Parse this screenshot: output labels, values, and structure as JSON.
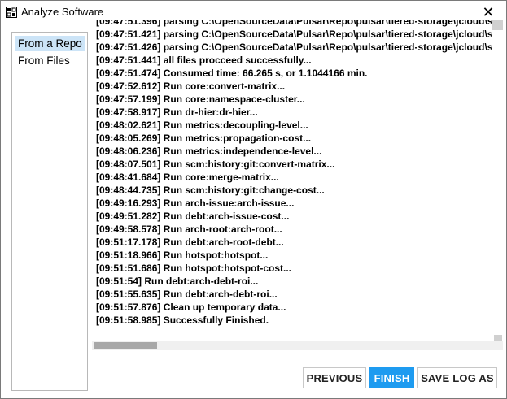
{
  "window": {
    "title": "Analyze Software",
    "close_glyph": "✕"
  },
  "sidebar": {
    "items": [
      {
        "label": "From a Repo",
        "selected": true
      },
      {
        "label": "From Files",
        "selected": false
      }
    ]
  },
  "log": {
    "lines": [
      "[09:47:51.396] parsing C:\\OpenSourceData\\Pulsar\\Repo\\pulsar\\tiered-storage\\jcloud\\s",
      "[09:47:51.421] parsing C:\\OpenSourceData\\Pulsar\\Repo\\pulsar\\tiered-storage\\jcloud\\s",
      "[09:47:51.426] parsing C:\\OpenSourceData\\Pulsar\\Repo\\pulsar\\tiered-storage\\jcloud\\s",
      "[09:47:51.441] all files procceed successfully...",
      "[09:47:51.474] Consumed time: 66.265 s,  or 1.1044166 min.",
      "[09:47:52.612] Run core:convert-matrix...",
      "[09:47:57.199] Run core:namespace-cluster...",
      "[09:47:58.917] Run dr-hier:dr-hier...",
      "[09:48:02.621] Run metrics:decoupling-level...",
      "[09:48:05.269] Run metrics:propagation-cost...",
      "[09:48:06.236] Run metrics:independence-level...",
      "[09:48:07.501] Run scm:history:git:convert-matrix...",
      "[09:48:41.684] Run core:merge-matrix...",
      "[09:48:44.735] Run scm:history:git:change-cost...",
      "[09:49:16.293] Run arch-issue:arch-issue...",
      "[09:49:51.282] Run debt:arch-issue-cost...",
      "[09:49:58.578] Run arch-root:arch-root...",
      "[09:51:17.178] Run debt:arch-root-debt...",
      "[09:51:18.966] Run hotspot:hotspot...",
      "[09:51:51.686] Run hotspot:hotspot-cost...",
      "[09:51:54] Run debt:arch-debt-roi...",
      "[09:51:55.635] Run debt:arch-debt-roi...",
      "[09:51:57.876] Clean up temporary data...",
      "[09:51:58.985] Successfully Finished."
    ]
  },
  "buttons": {
    "previous": "PREVIOUS",
    "finish": "FINISH",
    "save_log": "SAVE LOG AS"
  },
  "colors": {
    "accent": "#1e9bf0",
    "selection": "#cce4f7"
  }
}
